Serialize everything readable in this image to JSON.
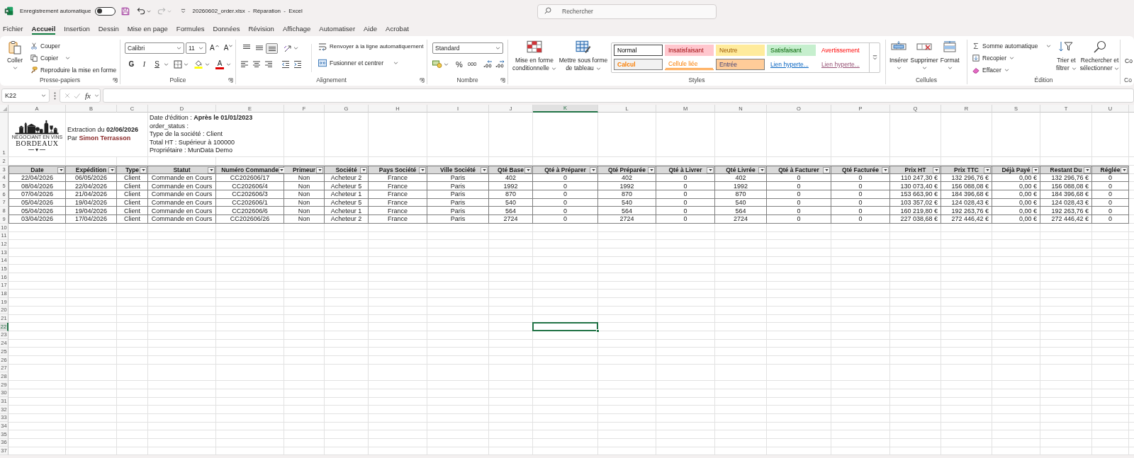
{
  "title_bar": {
    "autosave_label": "Enregistrement automatique",
    "autosave_on": false,
    "redo_enabled": false,
    "title": "20260602_order.xlsx - Réparation - Excel",
    "search_placeholder": "Rechercher"
  },
  "menu_tabs": [
    {
      "label": "Fichier",
      "selected": false
    },
    {
      "label": "Accueil",
      "selected": true
    },
    {
      "label": "Insertion",
      "selected": false
    },
    {
      "label": "Dessin",
      "selected": false
    },
    {
      "label": "Mise en page",
      "selected": false
    },
    {
      "label": "Formules",
      "selected": false
    },
    {
      "label": "Données",
      "selected": false
    },
    {
      "label": "Révision",
      "selected": false
    },
    {
      "label": "Affichage",
      "selected": false
    },
    {
      "label": "Automatiser",
      "selected": false
    },
    {
      "label": "Aide",
      "selected": false
    },
    {
      "label": "Acrobat",
      "selected": false
    }
  ],
  "ribbon": {
    "clipboard": {
      "label": "Presse-papiers",
      "paste": "Coller",
      "cut": "Couper",
      "copy": "Copier",
      "format_painter": "Reproduire la mise en forme"
    },
    "font": {
      "label": "Police",
      "font_name": "Calibri",
      "font_size": "11",
      "grow": "A",
      "shrink": "A",
      "bold": "G",
      "italic": "I",
      "underline": "S",
      "font_color": "A"
    },
    "alignment": {
      "label": "Alignement",
      "vertical": [
        {
          "selected": false
        },
        {
          "selected": false
        },
        {
          "selected": true
        }
      ],
      "wrap_text": "Renvoyer à la ligne automatiquement",
      "merge": "Fusionner et centrer"
    },
    "number": {
      "label": "Nombre",
      "format": "Standard",
      "percent": "%",
      "thousands": "000"
    },
    "styles": {
      "label": "Styles",
      "conditional": [
        "Mise en forme",
        "conditionnelle"
      ],
      "as_table": [
        "Mettre sous forme",
        "de tableau"
      ],
      "cell_styles": [
        {
          "label": "Normal",
          "kind": "normal",
          "selected": true
        },
        {
          "label": "Insatisfaisant",
          "kind": "bad",
          "selected": false
        },
        {
          "label": "Neutre",
          "kind": "neutral",
          "selected": false
        },
        {
          "label": "Satisfaisant",
          "kind": "good",
          "selected": false
        },
        {
          "label": "Avertissement",
          "kind": "warning",
          "selected": false
        },
        {
          "label": "Calcul",
          "kind": "calc",
          "selected": false
        },
        {
          "label": "Cellule liée",
          "kind": "linked",
          "selected": false
        },
        {
          "label": "Entrée",
          "kind": "input",
          "selected": false
        },
        {
          "label": "Lien hyperte...",
          "kind": "hyperlink",
          "selected": false
        },
        {
          "label": "Lien hyperte...",
          "kind": "followed",
          "selected": false
        }
      ]
    },
    "cells": {
      "label": "Cellules",
      "buttons": [
        {
          "label": "Insérer",
          "kind": "insert"
        },
        {
          "label": "Supprimer",
          "kind": "delete"
        },
        {
          "label": "Format",
          "kind": "format"
        }
      ]
    },
    "editing": {
      "label": "Édition",
      "autosum": "Somme automatique",
      "fill": "Recopier",
      "clear": "Effacer",
      "sort": [
        "Trier et",
        "filtrer"
      ],
      "find": [
        "Rechercher et",
        "sélectionner"
      ]
    },
    "next": {
      "button": "Co",
      "label": "Co"
    }
  },
  "formula_bar": {
    "name_box": "K22",
    "edit_enabled": false,
    "function_label": "fx"
  },
  "sheet": {
    "columns": [
      {
        "letter": "A",
        "selected": false
      },
      {
        "letter": "B",
        "selected": false
      },
      {
        "letter": "C",
        "selected": false
      },
      {
        "letter": "D",
        "selected": false
      },
      {
        "letter": "E",
        "selected": false
      },
      {
        "letter": "F",
        "selected": false
      },
      {
        "letter": "G",
        "selected": false
      },
      {
        "letter": "H",
        "selected": false
      },
      {
        "letter": "I",
        "selected": false
      },
      {
        "letter": "J",
        "selected": false
      },
      {
        "letter": "K",
        "selected": true
      },
      {
        "letter": "L",
        "selected": false
      },
      {
        "letter": "M",
        "selected": false
      },
      {
        "letter": "N",
        "selected": false
      },
      {
        "letter": "O",
        "selected": false
      },
      {
        "letter": "P",
        "selected": false
      },
      {
        "letter": "Q",
        "selected": false
      },
      {
        "letter": "R",
        "selected": false
      },
      {
        "letter": "S",
        "selected": false
      },
      {
        "letter": "T",
        "selected": false
      },
      {
        "letter": "U",
        "selected": false
      }
    ],
    "rows": [
      {
        "number": "1",
        "selected": false
      },
      {
        "number": "2",
        "selected": false
      },
      {
        "number": "3",
        "selected": false
      },
      {
        "number": "4",
        "selected": false
      },
      {
        "number": "5",
        "selected": false
      },
      {
        "number": "6",
        "selected": false
      },
      {
        "number": "7",
        "selected": false
      },
      {
        "number": "8",
        "selected": false
      },
      {
        "number": "9",
        "selected": false
      },
      {
        "number": "10",
        "selected": false
      },
      {
        "number": "11",
        "selected": false
      },
      {
        "number": "12",
        "selected": false
      },
      {
        "number": "13",
        "selected": false
      },
      {
        "number": "14",
        "selected": false
      },
      {
        "number": "15",
        "selected": false
      },
      {
        "number": "16",
        "selected": false
      },
      {
        "number": "17",
        "selected": false
      },
      {
        "number": "18",
        "selected": false
      },
      {
        "number": "19",
        "selected": false
      },
      {
        "number": "20",
        "selected": false
      },
      {
        "number": "21",
        "selected": false
      },
      {
        "number": "22",
        "selected": true
      },
      {
        "number": "23",
        "selected": false
      },
      {
        "number": "24",
        "selected": false
      },
      {
        "number": "25",
        "selected": false
      },
      {
        "number": "26",
        "selected": false
      },
      {
        "number": "27",
        "selected": false
      },
      {
        "number": "28",
        "selected": false
      },
      {
        "number": "29",
        "selected": false
      },
      {
        "number": "30",
        "selected": false
      },
      {
        "number": "31",
        "selected": false
      },
      {
        "number": "32",
        "selected": false
      },
      {
        "number": "33",
        "selected": false
      },
      {
        "number": "34",
        "selected": false
      },
      {
        "number": "35",
        "selected": false
      },
      {
        "number": "36",
        "selected": false
      },
      {
        "number": "37",
        "selected": false
      }
    ]
  },
  "report_header": {
    "logo_tagline": "NÉGOCIANT EN VINS",
    "logo_name": "BORDEAUX",
    "credit_lines": [
      "Extraction du **02/06/2026**",
      "Par **Simon Terrasson**"
    ],
    "filter_lines": [
      "Date d'édition : **Après le 01/01/2023**",
      "order_status :",
      "Type de la société : Client",
      "Total HT : Supérieur à 100000",
      "Propriétaire : MunData Demo"
    ]
  },
  "table": {
    "columns": [
      {
        "label": "Date",
        "kind": "text"
      },
      {
        "label": "Expédition",
        "kind": "text"
      },
      {
        "label": "Type",
        "kind": "text"
      },
      {
        "label": "Statut",
        "kind": "text"
      },
      {
        "label": "Numéro Commande",
        "kind": "text"
      },
      {
        "label": "Primeur",
        "kind": "text"
      },
      {
        "label": "Société",
        "kind": "text"
      },
      {
        "label": "Pays Société",
        "kind": "text"
      },
      {
        "label": "Ville Société",
        "kind": "text"
      },
      {
        "label": "Qté Base",
        "kind": "number"
      },
      {
        "label": "Qté à Préparer",
        "kind": "number"
      },
      {
        "label": "Qté Préparée",
        "kind": "number"
      },
      {
        "label": "Qté à Livrer",
        "kind": "number"
      },
      {
        "label": "Qté Livrée",
        "kind": "number"
      },
      {
        "label": "Qté à Facturer",
        "kind": "number"
      },
      {
        "label": "Qté Facturée",
        "kind": "number"
      },
      {
        "label": "Prix HT",
        "kind": "money"
      },
      {
        "label": "Prix TTC",
        "kind": "money"
      },
      {
        "label": "Déjà Payé",
        "kind": "money"
      },
      {
        "label": "Restant Du",
        "kind": "money"
      },
      {
        "label": "Réglée",
        "kind": "number"
      }
    ],
    "rows": [
      [
        "22/04/2026",
        "06/05/2026",
        "Client",
        "Commande en Cours",
        "CC202606/17",
        "Non",
        "Acheteur 2",
        "France",
        "Paris",
        "402",
        "0",
        "402",
        "0",
        "402",
        "0",
        "0",
        "110 247,30 €",
        "132 296,76 €",
        "0,00 €",
        "132 296,76 €",
        "0"
      ],
      [
        "08/04/2026",
        "22/04/2026",
        "Client",
        "Commande en Cours",
        "CC202606/4",
        "Non",
        "Acheteur 5",
        "France",
        "Paris",
        "1992",
        "0",
        "1992",
        "0",
        "1992",
        "0",
        "0",
        "130 073,40 €",
        "156 088,08 €",
        "0,00 €",
        "156 088,08 €",
        "0"
      ],
      [
        "07/04/2026",
        "21/04/2026",
        "Client",
        "Commande en Cours",
        "CC202606/3",
        "Non",
        "Acheteur 1",
        "France",
        "Paris",
        "870",
        "0",
        "870",
        "0",
        "870",
        "0",
        "0",
        "153 663,90 €",
        "184 396,68 €",
        "0,00 €",
        "184 396,68 €",
        "0"
      ],
      [
        "05/04/2026",
        "19/04/2026",
        "Client",
        "Commande en Cours",
        "CC202606/1",
        "Non",
        "Acheteur 5",
        "France",
        "Paris",
        "540",
        "0",
        "540",
        "0",
        "540",
        "0",
        "0",
        "103 357,02 €",
        "124 028,43 €",
        "0,00 €",
        "124 028,43 €",
        "0"
      ],
      [
        "05/04/2026",
        "19/04/2026",
        "Client",
        "Commande en Cours",
        "CC202606/6",
        "Non",
        "Acheteur 1",
        "France",
        "Paris",
        "564",
        "0",
        "564",
        "0",
        "564",
        "0",
        "0",
        "160 219,80 €",
        "192 263,76 €",
        "0,00 €",
        "192 263,76 €",
        "0"
      ],
      [
        "03/04/2026",
        "17/04/2026",
        "Client",
        "Commande en Cours",
        "CC202606/26",
        "Non",
        "Acheteur 2",
        "France",
        "Paris",
        "2724",
        "0",
        "2724",
        "0",
        "2724",
        "0",
        "0",
        "227 038,68 €",
        "272 446,42 €",
        "0,00 €",
        "272 446,42 €",
        "0"
      ]
    ]
  }
}
